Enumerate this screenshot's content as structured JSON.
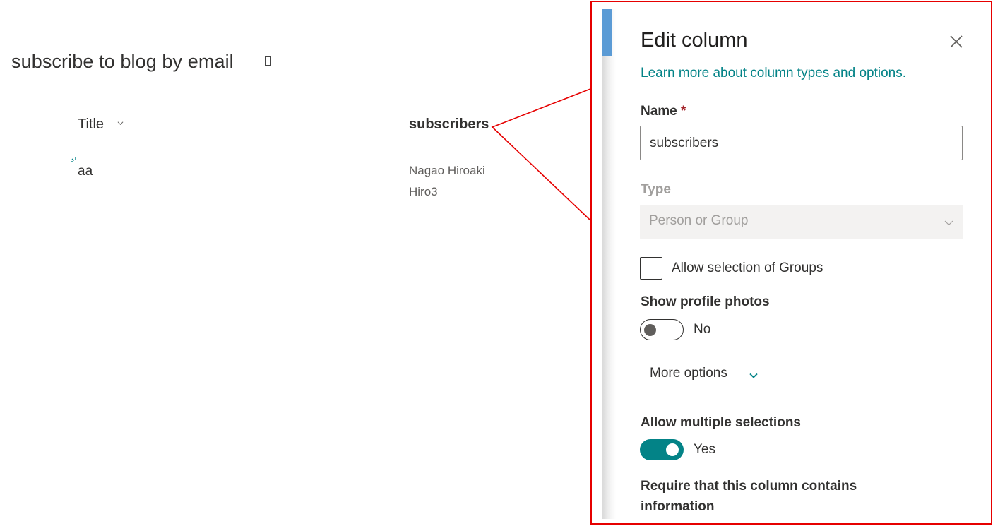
{
  "list": {
    "title": "subscribe to blog by email",
    "columns": {
      "title": "Title",
      "subscribers": "subscribers"
    },
    "rows": [
      {
        "title": "aa",
        "subscribers": [
          "Nagao Hiroaki",
          "Hiro3"
        ]
      }
    ]
  },
  "panel": {
    "title": "Edit column",
    "learn_link": "Learn more about column types and options.",
    "name_label": "Name",
    "required_mark": "*",
    "name_value": "subscribers",
    "type_label": "Type",
    "type_value": "Person or Group",
    "allow_groups_label": "Allow selection of Groups",
    "show_photos_label": "Show profile photos",
    "show_photos_state": "No",
    "more_options": "More options",
    "allow_multiple_label": "Allow multiple selections",
    "allow_multiple_state": "Yes",
    "require_label_line1": "Require that this column contains",
    "require_label_line2": "information"
  },
  "colors": {
    "accent": "#038387",
    "callout": "#e60000",
    "scroll_thumb": "#5b9bd5"
  },
  "icons": [
    "chevron-down-icon",
    "loading-icon",
    "close-icon"
  ]
}
